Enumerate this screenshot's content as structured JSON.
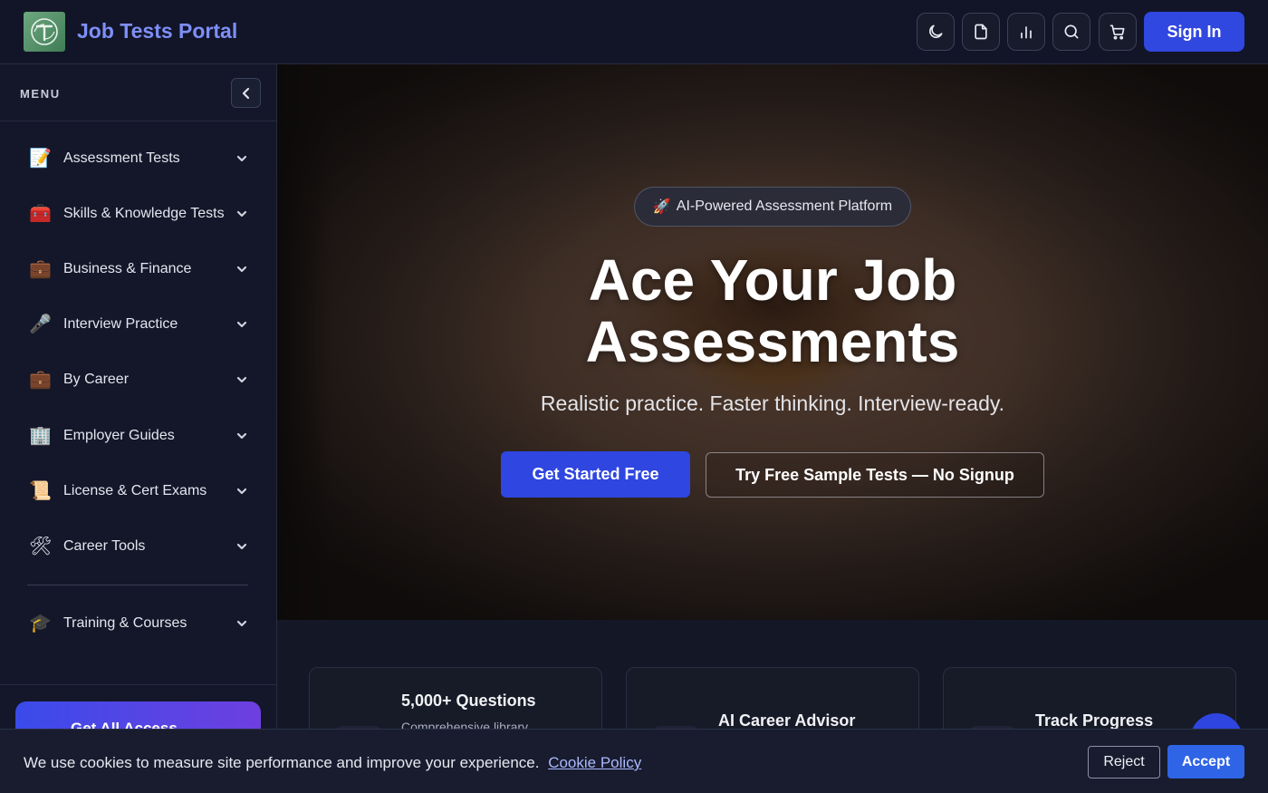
{
  "header": {
    "brand": "Job Tests Portal",
    "sign_in_label": "Sign In",
    "icons": [
      "moon-icon",
      "document-icon",
      "bar-chart-icon",
      "search-icon",
      "cart-icon"
    ]
  },
  "sidebar": {
    "title": "MENU",
    "items": [
      {
        "icon": "📝",
        "label": "Assessment Tests"
      },
      {
        "icon": "🧰",
        "label": "Skills & Knowledge Tests"
      },
      {
        "icon": "💼",
        "label": "Business & Finance"
      },
      {
        "icon": "🎤",
        "label": "Interview Practice"
      },
      {
        "icon": "💼",
        "label": "By Career"
      },
      {
        "icon": "🏢",
        "label": "Employer Guides"
      },
      {
        "icon": "📜",
        "label": "License & Cert Exams"
      },
      {
        "icon": "🛠",
        "label": "Career Tools"
      },
      {
        "icon": "🎓",
        "label": "Training & Courses"
      }
    ],
    "cta_label": "Get All Access"
  },
  "hero": {
    "badge_icon": "🚀",
    "badge_text": "AI-Powered Assessment Platform",
    "title_line1": "Ace Your Job",
    "title_line2": "Assessments",
    "subtitle": "Realistic practice. Faster thinking. Interview-ready.",
    "primary_cta": "Get Started Free",
    "secondary_cta": "Try Free Sample Tests — No Signup"
  },
  "features": [
    {
      "title": "5,000+ Questions",
      "desc": "Comprehensive library"
    },
    {
      "title": "AI Career Advisor",
      "desc": ""
    },
    {
      "title": "Track Progress",
      "desc": ""
    }
  ],
  "cookie": {
    "text": "We use cookies to measure site performance and improve your experience.",
    "link": "Cookie Policy",
    "reject": "Reject",
    "accept": "Accept"
  },
  "colors": {
    "accent": "#3047e0",
    "brand_text": "#7e8ff7",
    "background": "#141826"
  }
}
